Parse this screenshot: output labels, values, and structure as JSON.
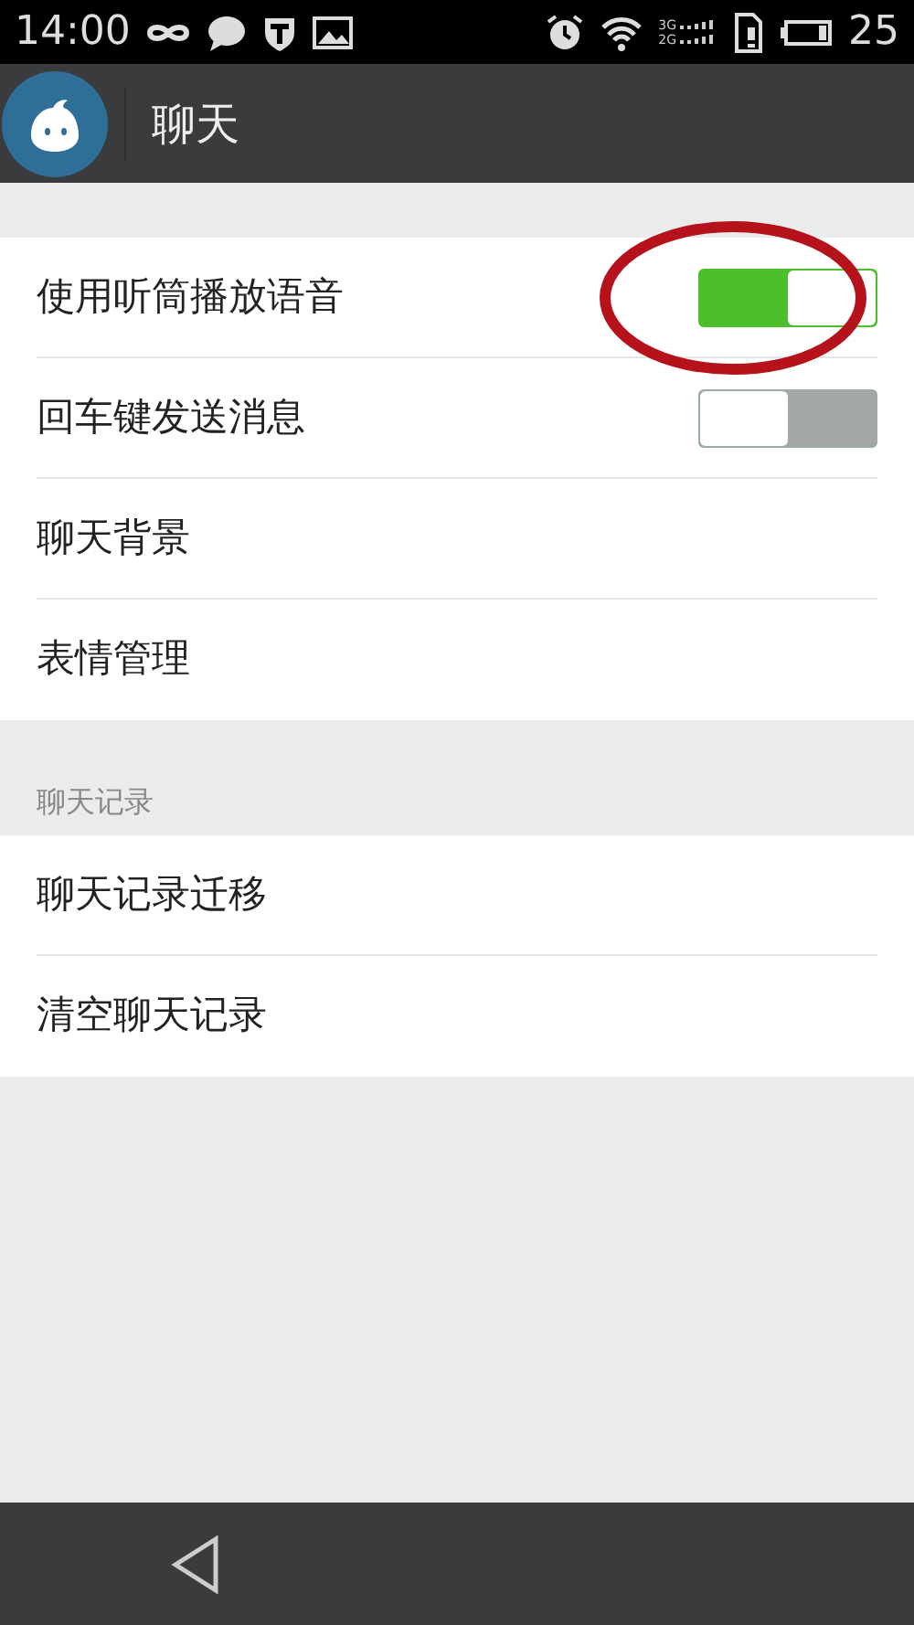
{
  "status_bar": {
    "time": "14:00",
    "network_labels": [
      "3G",
      "2G"
    ],
    "battery": "25"
  },
  "header": {
    "title": "聊天"
  },
  "sections": [
    {
      "items": [
        {
          "label": "使用听筒播放语音",
          "kind": "toggle",
          "on": true,
          "highlighted": true
        },
        {
          "label": "回车键发送消息",
          "kind": "toggle",
          "on": false,
          "highlighted": false
        },
        {
          "label": "聊天背景",
          "kind": "link"
        },
        {
          "label": "表情管理",
          "kind": "link"
        }
      ]
    },
    {
      "title": "聊天记录",
      "items": [
        {
          "label": "聊天记录迁移",
          "kind": "link"
        },
        {
          "label": "清空聊天记录",
          "kind": "link"
        }
      ]
    }
  ]
}
